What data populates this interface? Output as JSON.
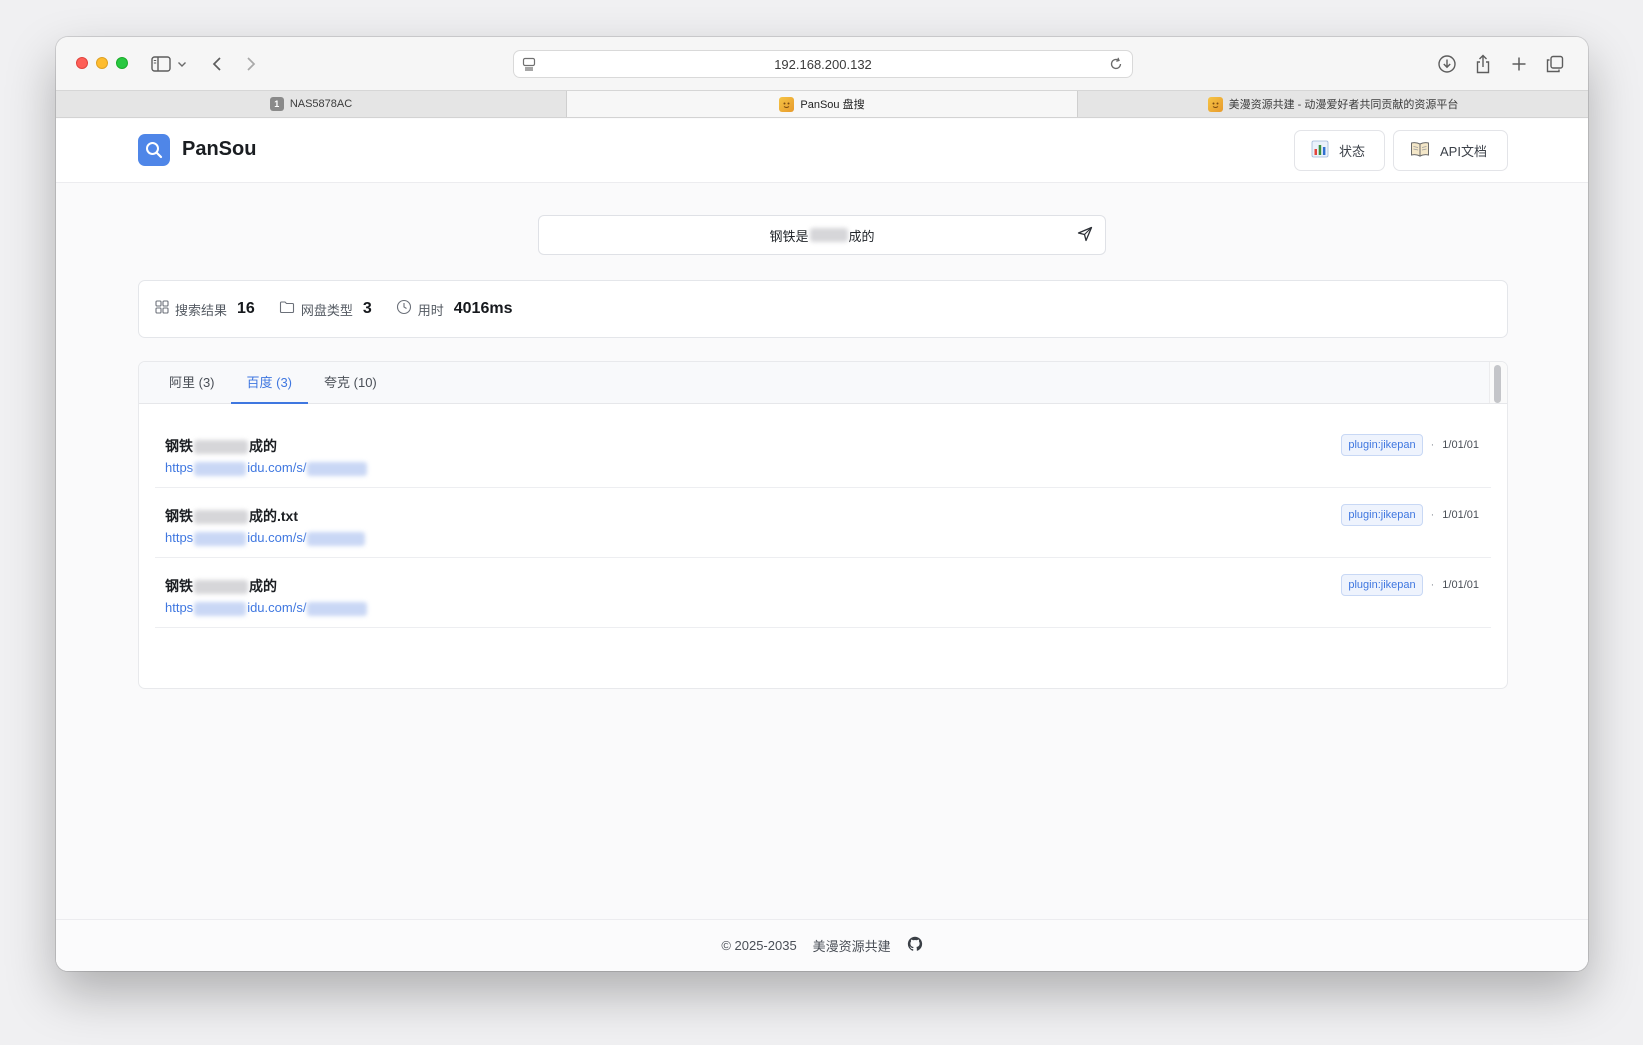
{
  "browser": {
    "address": "192.168.200.132",
    "tabs": [
      {
        "label": "NAS5878AC",
        "favicon": "1"
      },
      {
        "label": "PanSou 盘搜",
        "favicon": "mascot"
      },
      {
        "label": "美漫资源共建 - 动漫爱好者共同贡献的资源平台",
        "favicon": "mascot"
      }
    ]
  },
  "header": {
    "brand": "PanSou",
    "status_label": "状态",
    "api_label": "API文档"
  },
  "search": {
    "query_prefix": "钢铁是",
    "query_suffix": "成的"
  },
  "stats": {
    "results_label": "搜索结果",
    "results_value": "16",
    "types_label": "网盘类型",
    "types_value": "3",
    "time_label": "用时",
    "time_value": "4016ms"
  },
  "result_tabs": [
    {
      "label": "阿里 (3)",
      "active": false
    },
    {
      "label": "百度 (3)",
      "active": true
    },
    {
      "label": "夸克 (10)",
      "active": false
    }
  ],
  "results": [
    {
      "title_prefix": "钢铁",
      "title_suffix": "成的",
      "link_prefix": "https",
      "link_mid": "idu.com/s/",
      "tag": "plugin:jikepan",
      "sep": "·",
      "date": "1/01/01"
    },
    {
      "title_prefix": "钢铁",
      "title_suffix": "成的.txt",
      "link_prefix": "https",
      "link_mid": "idu.com/s/",
      "tag": "plugin:jikepan",
      "sep": "·",
      "date": "1/01/01"
    },
    {
      "title_prefix": "钢铁",
      "title_suffix": "成的",
      "link_prefix": "https",
      "link_mid": "idu.com/s/",
      "tag": "plugin:jikepan",
      "sep": "·",
      "date": "1/01/01"
    }
  ],
  "footer": {
    "copyright": "© 2025-2035",
    "site": "美漫资源共建"
  },
  "colors": {
    "accent": "#3f77e0",
    "logo": "#4f86e8"
  }
}
